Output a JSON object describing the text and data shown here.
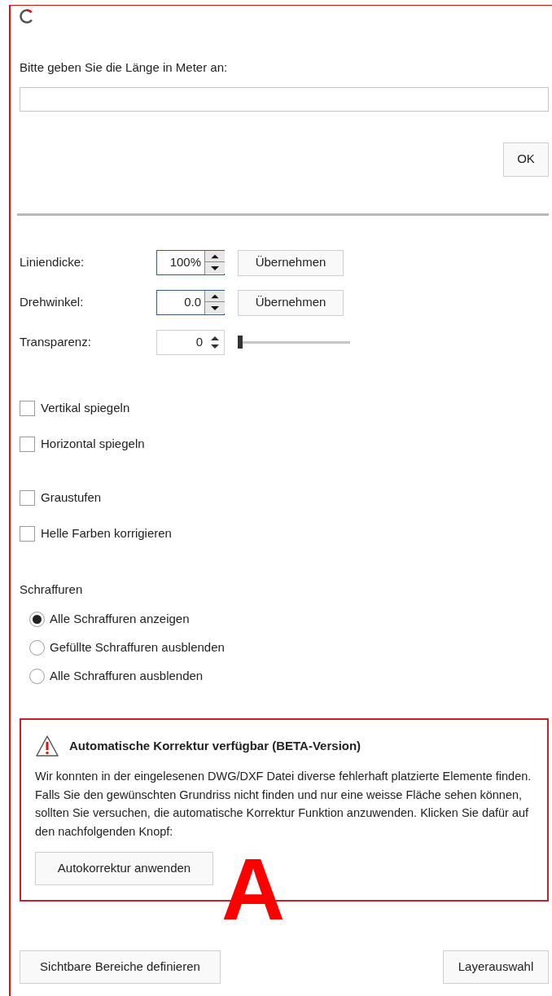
{
  "length_prompt": {
    "label": "Bitte geben Sie die Länge in Meter an:",
    "ok_button": "OK"
  },
  "settings": [
    {
      "kind": "boxed",
      "label": "Liniendicke:",
      "value": "100%",
      "focused": true,
      "apply_button": "Übernehmen"
    },
    {
      "kind": "boxed",
      "label": "Drehwinkel:",
      "value": "0.0",
      "focused": true,
      "apply_button": "Übernehmen"
    },
    {
      "kind": "slider",
      "label": "Transparenz:",
      "value": "0",
      "focused": false,
      "level": 0
    }
  ],
  "checkbox_groups": [
    [
      {
        "label": "Vertikal spiegeln",
        "checked": false
      },
      {
        "label": "Horizontal spiegeln",
        "checked": false
      }
    ],
    [
      {
        "label": "Graustufen",
        "checked": false
      },
      {
        "label": "Helle Farben korrigieren",
        "checked": false
      }
    ]
  ],
  "hatching": {
    "title": "Schraffuren",
    "options": [
      {
        "label": "Alle Schraffuren anzeigen",
        "selected": true
      },
      {
        "label": "Gefüllte Schraffuren ausblenden",
        "selected": false
      },
      {
        "label": "Alle Schraffuren ausblenden",
        "selected": false
      }
    ]
  },
  "warning": {
    "title": "Automatische Korrektur verfügbar (BETA-Version)",
    "text": "Wir konnten in der eingelesenen DWG/DXF Datei diverse fehlerhaft platzierte Elemente finden. Falls Sie den gewünschten Grundriss nicht finden und nur eine weisse Fläche sehen können, sollten Sie versuchen, die automatische Korrektur Funktion anzuwenden. Klicken Sie dafür auf den nachfolgenden Knopf:",
    "button": "Autokorrektur anwenden"
  },
  "annotation": "A",
  "footer_buttons": {
    "left": "Sichtbare Bereiche definieren",
    "right": "Layerauswahl"
  }
}
